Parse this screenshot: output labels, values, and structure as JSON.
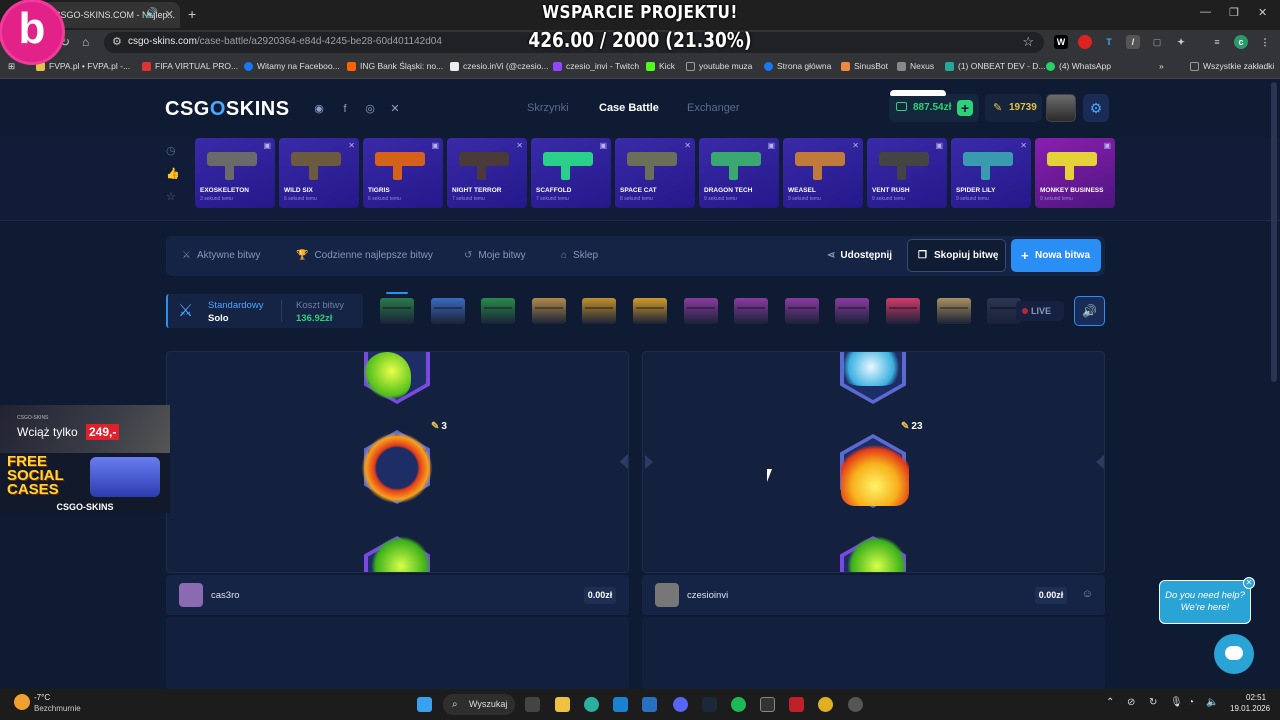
{
  "browser": {
    "tab_title": "CSGO-SKINS.COM - Najlep...",
    "url_host": "csgo-skins.com",
    "url_path": "/case-battle/a2920364-e84d-4245-be28-60d401142d04",
    "bookmarks": [
      {
        "label": "FVPA.pl • FVPA.pl -...",
        "color": "#e5c14b"
      },
      {
        "label": "FIFA VIRTUAL PRO...",
        "color": "#d33"
      },
      {
        "label": "Witamy na Faceboo...",
        "color": "#1877f2"
      },
      {
        "label": "ING Bank Śląski: no...",
        "color": "#ff6200"
      },
      {
        "label": "czesio.inVi (@czesio...",
        "color": "#eee"
      },
      {
        "label": "czesio_invi - Twitch",
        "color": "#9146ff"
      },
      {
        "label": "Kick",
        "color": "#53fc18"
      },
      {
        "label": "youtube muza",
        "color": "#999"
      },
      {
        "label": "Strona główna",
        "color": "#1877f2"
      },
      {
        "label": "SinusBot",
        "color": "#e84"
      },
      {
        "label": "Nexus",
        "color": "#888"
      },
      {
        "label": "(1) ONBEAT DEV - D...",
        "color": "#2a9"
      },
      {
        "label": "(4) WhatsApp",
        "color": "#25d366"
      }
    ],
    "all_bookmarks": "Wszystkie zakładki"
  },
  "stream_overlay": {
    "title": "WSPARCIE PROJEKTU!",
    "progress": "426.00 / 2000 (21.30%)",
    "progress_fraction": 0.213,
    "logo_letter": "b"
  },
  "header": {
    "logo_left": "CSG",
    "logo_o": "O",
    "logo_right": "SKINS",
    "nav": [
      "Skrzynki",
      "Case Battle",
      "Exchanger"
    ],
    "active_nav": "Case Battle",
    "balance": "887.54zł",
    "coins": "19739"
  },
  "drops": [
    {
      "name": "EXOSKELETON",
      "time": "3 sekund temu",
      "gun": "#6a6a6a",
      "pink": false
    },
    {
      "name": "WILD SIX",
      "time": "6 sekund temu",
      "gun": "#6b5a40",
      "pink": false
    },
    {
      "name": "TIGRIS",
      "time": "6 sekund temu",
      "gun": "#d4621a",
      "pink": false
    },
    {
      "name": "NIGHT TERROR",
      "time": "7 sekund temu",
      "gun": "#4a3a3a",
      "pink": false
    },
    {
      "name": "SCAFFOLD",
      "time": "7 sekund temu",
      "gun": "#2ad08a",
      "pink": false
    },
    {
      "name": "SPACE CAT",
      "time": "8 sekund temu",
      "gun": "#6b6f5a",
      "pink": false
    },
    {
      "name": "DRAGON TECH",
      "time": "9 sekund temu",
      "gun": "#3aa870",
      "pink": false
    },
    {
      "name": "WEASEL",
      "time": "9 sekund temu",
      "gun": "#c07a3a",
      "pink": false
    },
    {
      "name": "VENT RUSH",
      "time": "9 sekund temu",
      "gun": "#444",
      "pink": false
    },
    {
      "name": "SPIDER LILY",
      "time": "9 sekund temu",
      "gun": "#3a9ab0",
      "pink": false
    },
    {
      "name": "MONKEY BUSINESS",
      "time": "9 sekund temu",
      "gun": "#e5d23a",
      "pink": true
    }
  ],
  "toolbar": {
    "active_battles": "Aktywne bitwy",
    "daily_best": "Codzienne najlepsze bitwy",
    "my_battles": "Moje bitwy",
    "shop": "Sklep",
    "share": "Udostępnij",
    "copy": "Skopiuj bitwę",
    "new_battle": "Nowa bitwa"
  },
  "battle": {
    "mode_label": "Standardowy",
    "mode_value": "Solo",
    "cost_label": "Koszt bitwy",
    "cost_value": "136.92zł",
    "cases": [
      "#2a7a4a",
      "#3a6ac0",
      "#2a8a4a",
      "#b08a4a",
      "#c0902a",
      "#d09a2a",
      "#8a3aa0",
      "#8a3aa0",
      "#8a3aa0",
      "#8a3aa0",
      "#d03a6a",
      "#a89060",
      "#2a3550"
    ],
    "live": "LIVE"
  },
  "players": [
    {
      "name": "cas3ro",
      "amount": "0.00zł",
      "coins": "3",
      "avatar": "#8a6ab0"
    },
    {
      "name": "czesioinvi",
      "amount": "0.00zł",
      "coins": "23",
      "avatar": "#777"
    }
  ],
  "promo": {
    "brand_small": "CSGO-SKINS",
    "text1": "Wciąż tylko",
    "price": "249,-",
    "free": "FREE SOCIAL CASES",
    "brand": "CSGO-SKINS"
  },
  "help": {
    "text": "Do you need help? We're here!"
  },
  "taskbar": {
    "temp": "-7°C",
    "weather": "Bezchmurnie",
    "search": "Wyszukaj",
    "time": "02:51",
    "date": "19.01.2026"
  }
}
